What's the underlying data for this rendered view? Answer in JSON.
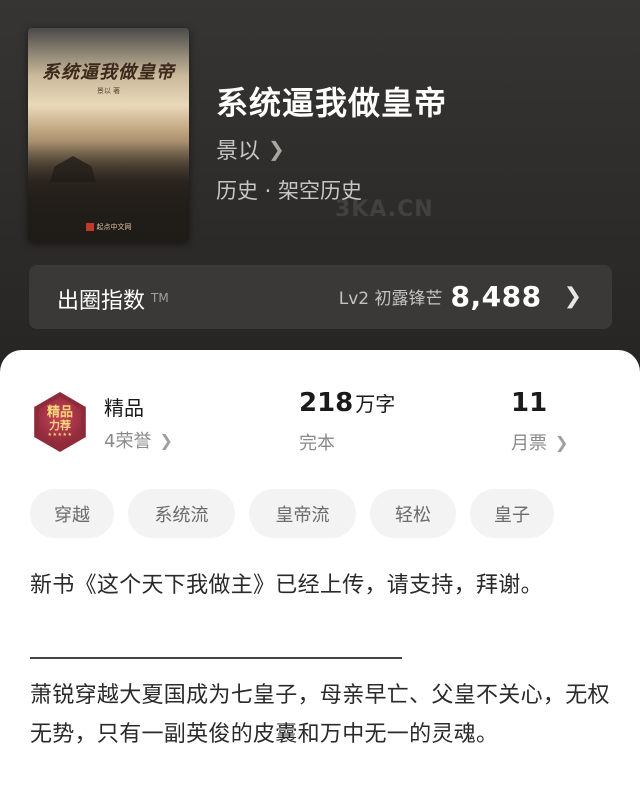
{
  "book": {
    "cover_title": "系统逼我做皇帝",
    "cover_author": "景以 著",
    "cover_publisher": "起点中文网",
    "title": "系统逼我做皇帝",
    "author": "景以",
    "genre": "历史 · 架空历史"
  },
  "watermark": "3KA.CN",
  "index": {
    "label": "出圈指数",
    "tm": "TM",
    "level": "Lv2 初露锋芒",
    "score": "8,488"
  },
  "stats": {
    "quality_title": "精品",
    "honors": "4荣誉",
    "badge_line1": "精品",
    "badge_line2": "力荐",
    "word_count": "218",
    "word_unit": "万字",
    "status": "完本",
    "monthly_votes": "11",
    "monthly_votes_label": "月票"
  },
  "tags": [
    "穿越",
    "系统流",
    "皇帝流",
    "轻松",
    "皇子"
  ],
  "intro": {
    "notice": "新书《这个天下我做主》已经上传，请支持，拜谢。",
    "synopsis": "萧锐穿越大夏国成为七皇子，母亲早亡、父皇不关心，无权无势，只有一副英俊的皮囊和万中无一的灵魂。"
  },
  "icons": {
    "author_chevron": "chevron-right-icon",
    "index_chevron": "chevron-right-icon"
  },
  "colors": {
    "header_bg": "#2c2b29",
    "index_bar_bg": "#3a3937",
    "badge": "#8e2a3a",
    "tag_bg": "#f3f3f3"
  }
}
